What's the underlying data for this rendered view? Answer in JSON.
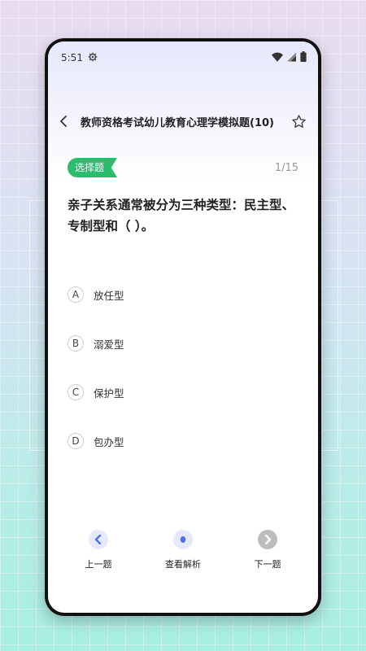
{
  "status_bar": {
    "time": "5:51"
  },
  "header": {
    "title": "教师资格考试幼儿教育心理学模拟题(10)"
  },
  "question": {
    "type_label": "选择题",
    "progress": "1/15",
    "text": "亲子关系通常被分为三种类型：民主型、专制型和（ ）。",
    "options": [
      {
        "letter": "A",
        "text": "放任型"
      },
      {
        "letter": "B",
        "text": "溺爱型"
      },
      {
        "letter": "C",
        "text": "保护型"
      },
      {
        "letter": "D",
        "text": "包办型"
      }
    ]
  },
  "bottom_nav": {
    "prev_label": "上一题",
    "analysis_label": "查看解析",
    "next_label": "下一题"
  },
  "colors": {
    "badge_green": "#2bbd6e",
    "accent_blue": "#4f6ef0",
    "disabled_gray": "#bdbdbd"
  }
}
